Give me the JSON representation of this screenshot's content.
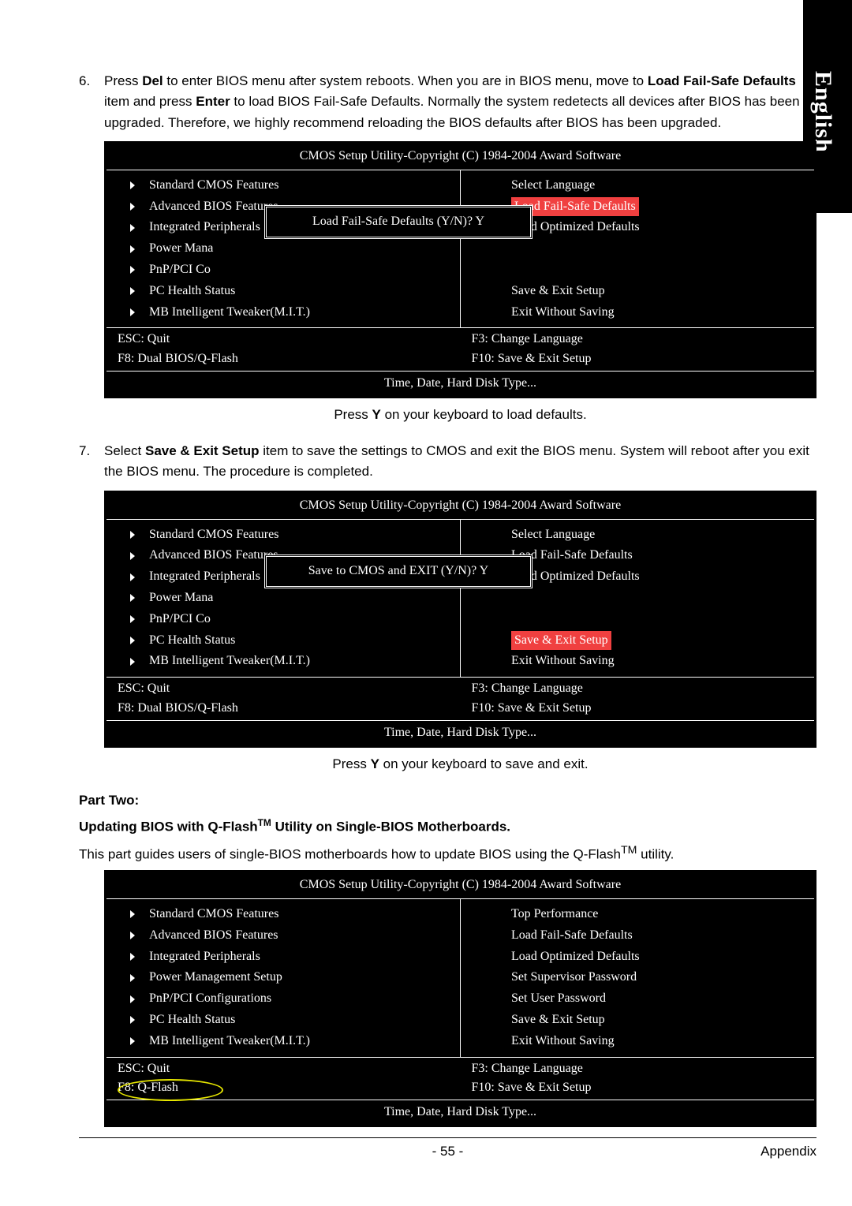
{
  "side_tab": "English",
  "step6": {
    "num": "6.",
    "t1": "Press ",
    "del": "Del",
    "t2": " to enter BIOS menu after system reboots. When you are in BIOS menu, move to ",
    "lfs": "Load Fail-Safe Defaults",
    "t3": " item and press ",
    "enter": "Enter",
    "t4": " to load BIOS Fail-Safe Defaults. Normally the system redetects all devices after BIOS has been upgraded. Therefore, we highly recommend reloading the BIOS defaults after BIOS has been upgraded."
  },
  "bios": {
    "title": "CMOS Setup Utility-Copyright (C) 1984-2004 Award Software",
    "left_items": [
      "Standard CMOS Features",
      "Advanced BIOS Features",
      "Integrated Peripherals",
      "Power Management Setup",
      "PnP/PCI Configurations",
      "PC Health Status",
      "MB Intelligent Tweaker(M.I.T.)"
    ],
    "left_trunc": {
      "3": "Power Mana",
      "4": "PnP/PCI Co"
    },
    "right_a": {
      "0": "Select Language",
      "1": "Load Fail-Safe Defaults",
      "2": "Load Optimized Defaults",
      "5": "Save & Exit Setup",
      "6": "Exit Without Saving"
    },
    "right_c": [
      "Top Performance",
      "Load Fail-Safe Defaults",
      "Load Optimized Defaults",
      "Set Supervisor Password",
      "Set User Password",
      "Save & Exit Setup",
      "Exit Without Saving"
    ],
    "popup1": "Load Fail-Safe Defaults (Y/N)? Y",
    "popup2": "Save to CMOS and EXIT (Y/N)? Y",
    "foot": {
      "esc": "ESC: Quit",
      "f3": "F3: Change Language",
      "f8a": "F8: Dual BIOS/Q-Flash",
      "f8b": "F8: Q-Flash",
      "f10": "F10: Save & Exit Setup"
    },
    "foot2": "Time, Date, Hard Disk Type..."
  },
  "caption1_a": "Press ",
  "caption1_b": "Y",
  "caption1_c": " on your keyboard to load defaults.",
  "step7": {
    "num": "7.",
    "t1": "Select ",
    "sel": "Save & Exit Setup",
    "t2": " item to save the settings to CMOS and exit the BIOS menu. System will reboot after you exit the BIOS menu. The procedure is completed."
  },
  "caption2_a": "Press ",
  "caption2_b": "Y",
  "caption2_c": " on your keyboard to save and exit.",
  "part_two": {
    "h": "Part Two:",
    "sub_a": "Updating BIOS with Q-Flash",
    "sub_tm": "TM",
    "sub_b": " Utility on Single-BIOS Motherboards.",
    "body_a": "This part guides users of single-BIOS motherboards how to update BIOS using the Q-Flash",
    "body_tm": "TM",
    "body_b": " utility."
  },
  "footer": {
    "page": "- 55 -",
    "section": "Appendix"
  }
}
